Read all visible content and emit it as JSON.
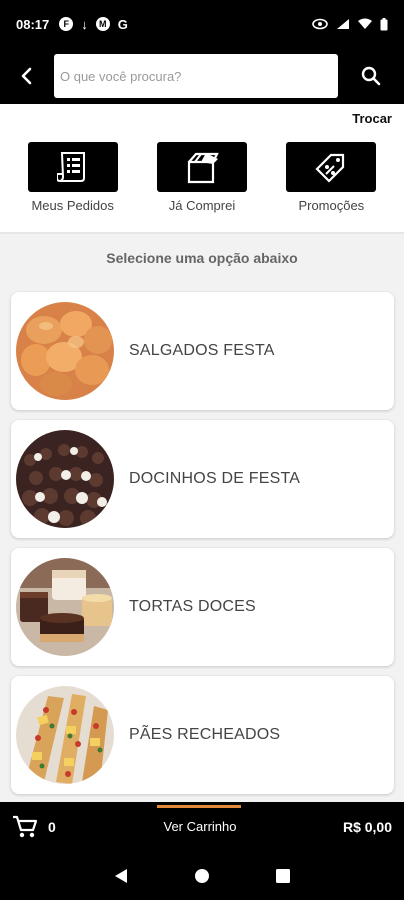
{
  "status_bar": {
    "time": "08:17",
    "left_icons": [
      "F",
      "↓",
      "M",
      "G"
    ]
  },
  "header": {
    "search_placeholder": "O que você procura?"
  },
  "trocar_label": "Trocar",
  "quick_actions": [
    {
      "label": "Meus Pedidos",
      "icon": "receipt-icon"
    },
    {
      "label": "Já Comprei",
      "icon": "box-icon"
    },
    {
      "label": "Promoções",
      "icon": "tag-icon"
    }
  ],
  "subtitle": "Selecione uma opção abaixo",
  "categories": [
    {
      "label": "SALGADOS FESTA",
      "image": "salgados-image"
    },
    {
      "label": "DOCINHOS DE FESTA",
      "image": "docinhos-image"
    },
    {
      "label": "TORTAS DOCES",
      "image": "tortas-image"
    },
    {
      "label": "PÃES RECHEADOS",
      "image": "paes-image"
    }
  ],
  "bottom_bar": {
    "cart_count": "0",
    "view_cart_label": "Ver Carrinho",
    "total": "R$ 0,00"
  },
  "colors": {
    "accent": "#e38a3a",
    "bar": "#000000",
    "list_bg": "#f2f2f2"
  }
}
